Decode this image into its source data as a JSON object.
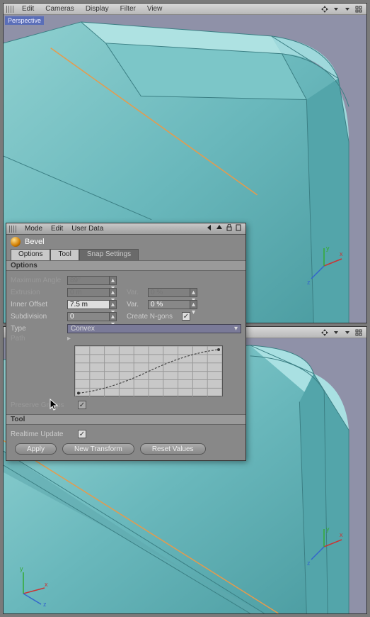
{
  "viewport": {
    "menus": [
      "Edit",
      "Cameras",
      "Display",
      "Filter",
      "View"
    ],
    "label": "Perspective"
  },
  "panel": {
    "menus": [
      "Mode",
      "Edit",
      "User Data"
    ],
    "title": "Bevel",
    "tabs": [
      "Options",
      "Tool",
      "Snap Settings"
    ],
    "section_options": "Options",
    "section_tool": "Tool",
    "rows": {
      "max_angle": {
        "label": "Maximum Angle",
        "value": "89°"
      },
      "extrusion": {
        "label": "Extrusion",
        "value": "0 m",
        "var_label": "Var.",
        "var_value": "0 %"
      },
      "inner_offset": {
        "label": "Inner Offset",
        "value": "7.5 m",
        "var_label": "Var.",
        "var_value": "0 %"
      },
      "subdivision": {
        "label": "Subdivision",
        "value": "0",
        "ngons_label": "Create N-gons"
      },
      "type": {
        "label": "Type",
        "value": "Convex"
      },
      "path": {
        "label": "Path"
      },
      "preserve": {
        "label": "Preserve Groups"
      },
      "realtime": {
        "label": "Realtime Update"
      }
    },
    "buttons": {
      "apply": "Apply",
      "new_transform": "New Transform",
      "reset": "Reset Values"
    }
  },
  "axis": {
    "x": "x",
    "y": "y",
    "z": "z"
  }
}
